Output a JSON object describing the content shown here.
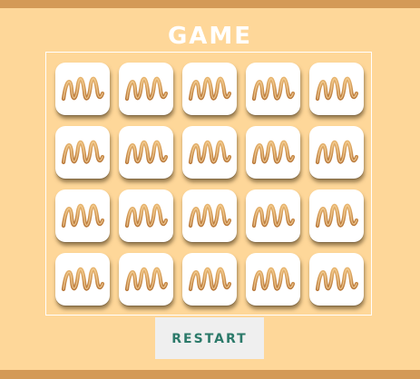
{
  "title": "GAME",
  "restart_label": "RESTART",
  "board": {
    "rows": 4,
    "columns": 5,
    "card_face": "ribbon-spiral-icon",
    "cards_face_down": 20
  },
  "colors": {
    "background": "#fed799",
    "bars": "#d49a57",
    "card": "#ffffff",
    "ribbon": "#d49a57",
    "restart_text": "#2c7a6a",
    "restart_bg": "#efefef"
  }
}
